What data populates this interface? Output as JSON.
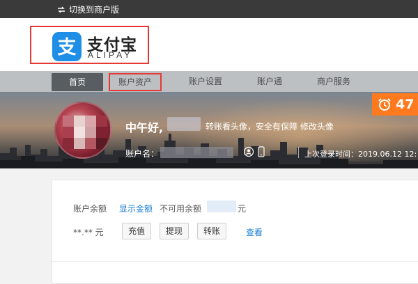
{
  "topbar": {
    "switch_label": "切换到商户版",
    "switch_icon": "swap-icon"
  },
  "logo": {
    "cn": "支付宝",
    "en": "ALIPAY",
    "mark_char": "支",
    "mark_color": "#1f8ee6",
    "highlight_color": "#e53935"
  },
  "nav": {
    "items": [
      {
        "label": "首页",
        "active": true
      },
      {
        "label": "账户资产",
        "active": false,
        "highlighted": true
      },
      {
        "label": "账户设置",
        "active": false
      },
      {
        "label": "账户通",
        "active": false
      },
      {
        "label": "商户服务",
        "active": false
      }
    ]
  },
  "banner": {
    "greeting": "中午好,",
    "tip": "转账看头像，安全有保障 修改头像",
    "account_label": "账户名：",
    "last_login": "上次登录时间：2019.06.12 12:",
    "badge_number": "47",
    "badge_color": "#ff7a1f",
    "icons": [
      "user-icon",
      "phone-icon",
      "alarm-clock-icon"
    ]
  },
  "account": {
    "balance_label": "账户余额",
    "show_balance_link": "显示金额",
    "unavailable_label": "不可用余额",
    "unavailable_unit": "元",
    "hidden_amount": "**.** 元",
    "buttons": {
      "recharge": "充值",
      "withdraw": "提现",
      "transfer": "转账"
    },
    "view_link": "查看",
    "link_color": "#1a7fd1"
  }
}
